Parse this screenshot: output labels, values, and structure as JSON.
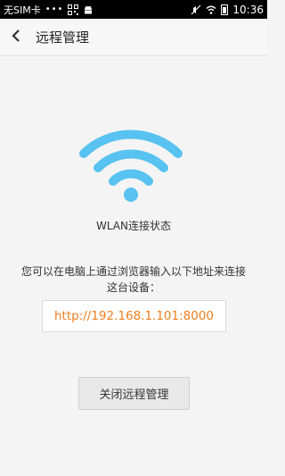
{
  "status_bar": {
    "carrier": "无SIM卡",
    "dots": "•••",
    "time": "10:36"
  },
  "header": {
    "title": "远程管理",
    "back_icon": "chevron-left-icon"
  },
  "main": {
    "wifi_icon": "wifi-icon",
    "wifi_color": "#58c2f0",
    "status_text": "WLAN连接状态",
    "instruction": "您可以在电脑上通过浏览器输入以下地址来连接这台设备：",
    "url": "http://192.168.1.101:8000",
    "url_color": "#ef7d1c",
    "close_button_label": "关闭远程管理"
  }
}
